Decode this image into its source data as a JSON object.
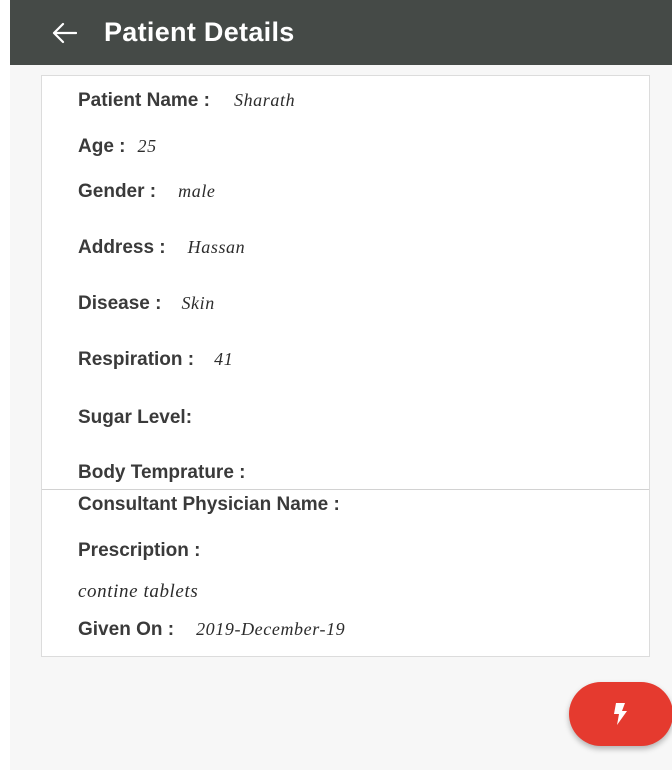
{
  "appbar": {
    "back_icon": "arrow-left-icon",
    "title": "Patient Details"
  },
  "patient": {
    "name_label": "Patient Name :",
    "name_value": "Sharath",
    "age_label": "Age :",
    "age_value": "25",
    "gender_label": "Gender :",
    "gender_value": "male",
    "address_label": "Address :",
    "address_value": "Hassan",
    "disease_label": "Disease :",
    "disease_value": "Skin",
    "respiration_label": "Respiration :",
    "respiration_value": "41",
    "sugar_label": "Sugar Level:",
    "temperature_label": "Body Temprature :"
  },
  "consultation": {
    "physician_label": "Consultant Physician Name :",
    "prescription_label": "Prescription :",
    "prescription_value": "contine tablets",
    "given_on_label": "Given On :",
    "given_on_value": "2019-December-19"
  },
  "fab": {
    "icon": "flash-icon",
    "color": "#e53a2f"
  },
  "colors": {
    "appbar": "#454a47",
    "background": "#f7f7f7",
    "card": "#ffffff"
  }
}
